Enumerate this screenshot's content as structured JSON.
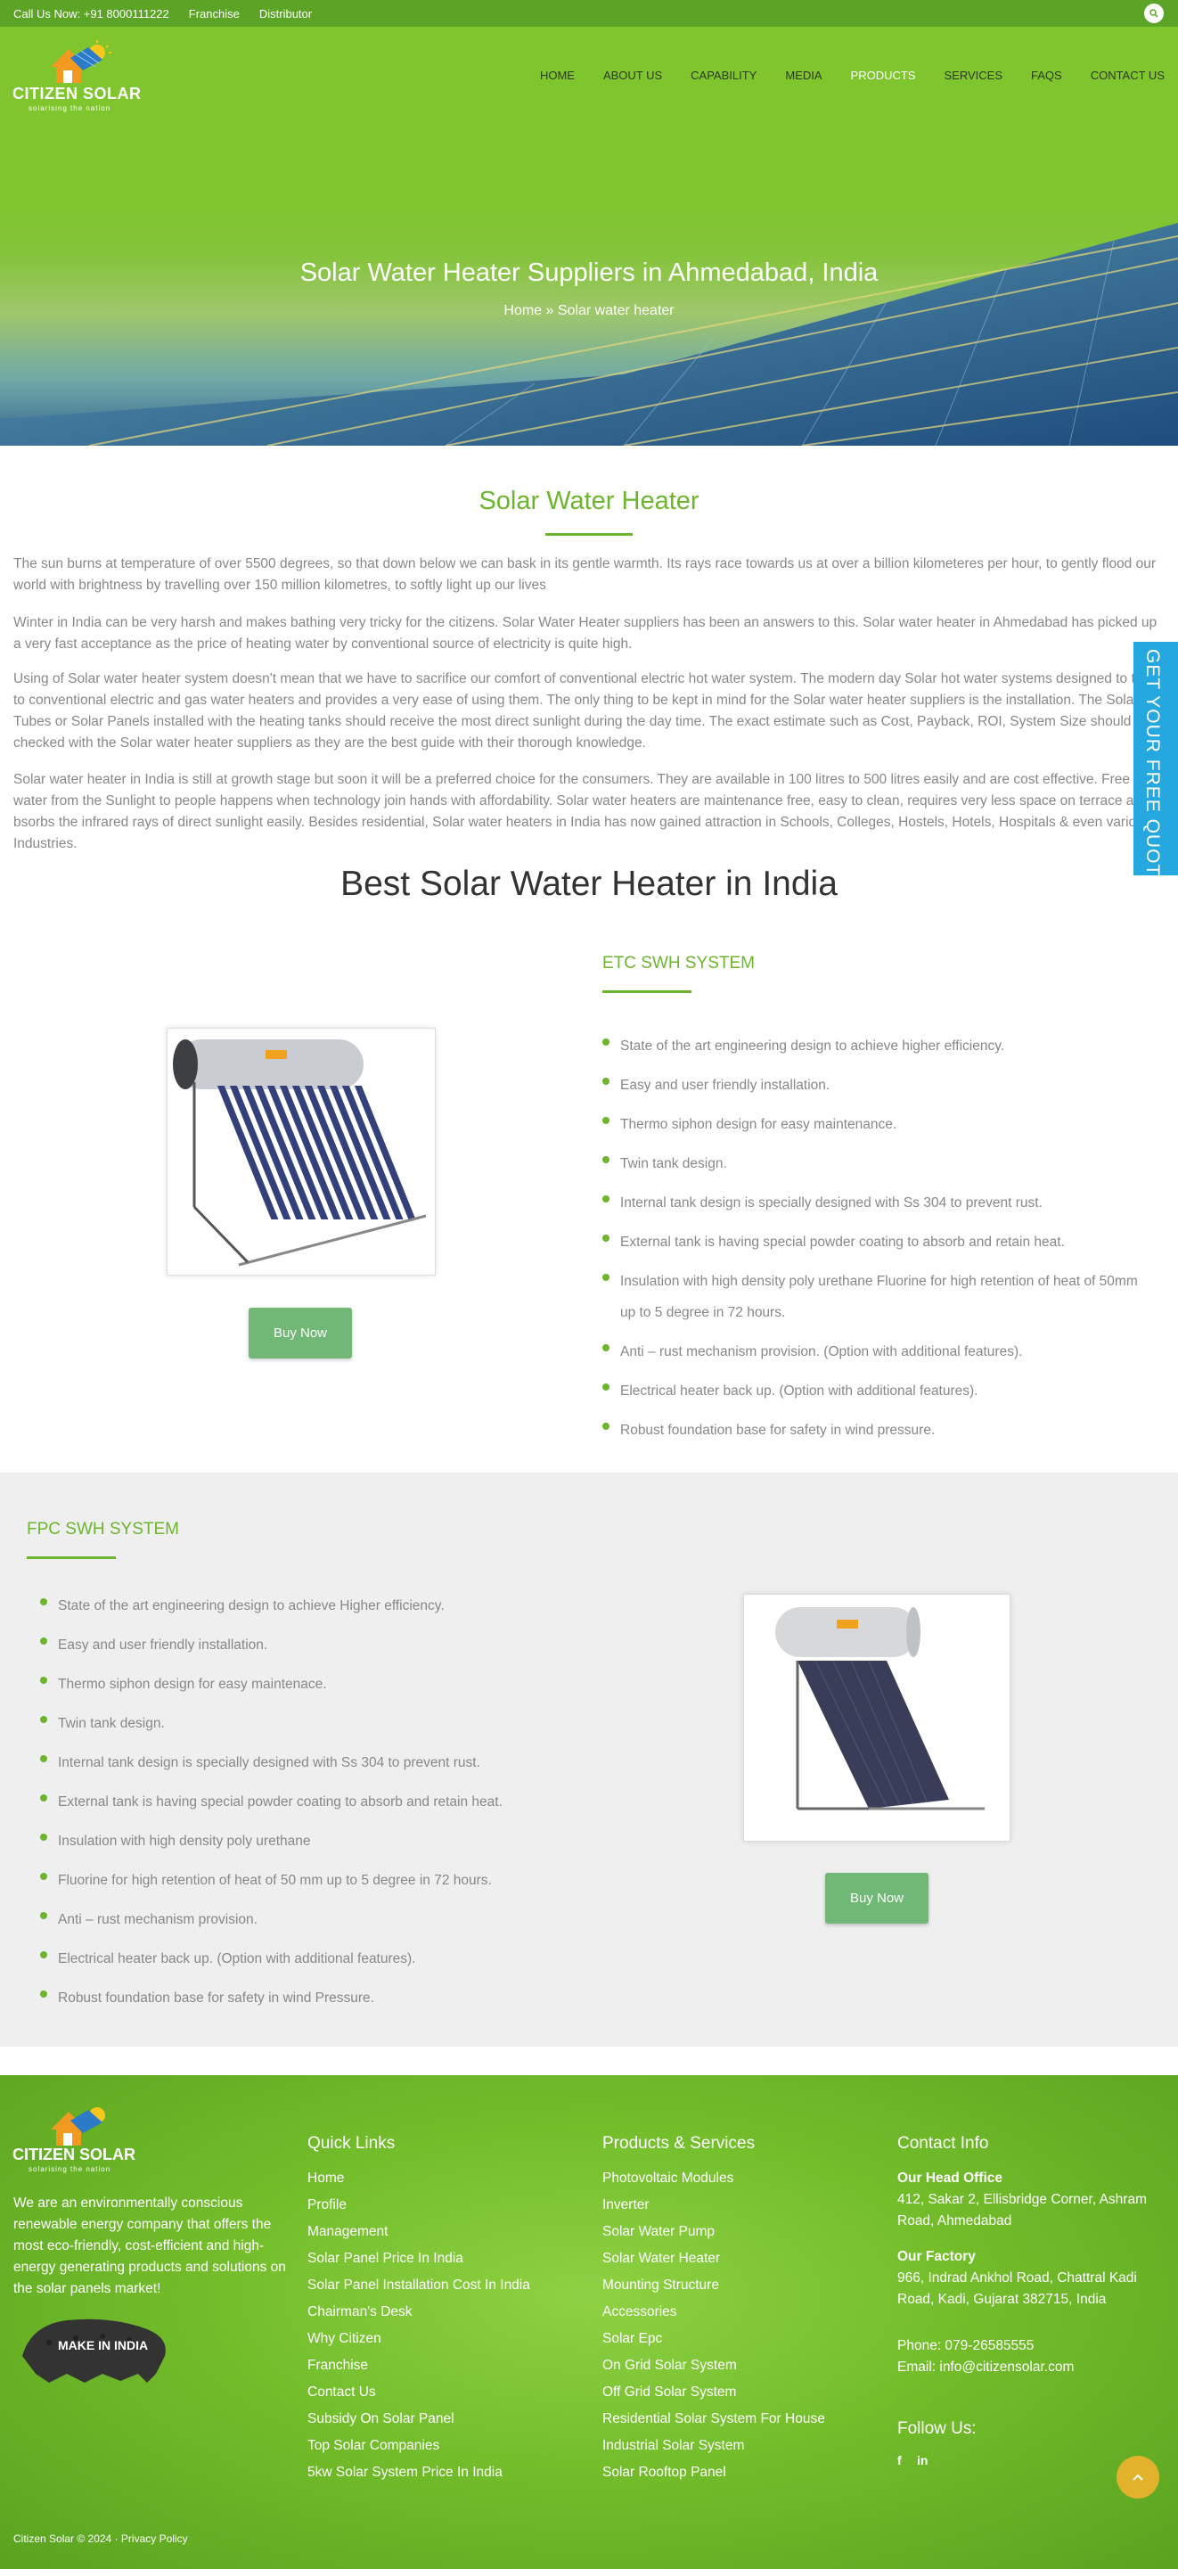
{
  "topbar": {
    "call": "Call Us Now: +91 8000111222",
    "franchise": "Franchise",
    "distributor": "Distributor"
  },
  "logo": {
    "name": "CITIZEN SOLAR",
    "tagline": "solarising the nation"
  },
  "nav": {
    "items": [
      {
        "label": "HOME"
      },
      {
        "label": "ABOUT US"
      },
      {
        "label": "CAPABILITY"
      },
      {
        "label": "MEDIA"
      },
      {
        "label": "PRODUCTS"
      },
      {
        "label": "SERVICES"
      },
      {
        "label": "FAQS"
      },
      {
        "label": "CONTACT US"
      }
    ],
    "active_index": 4
  },
  "hero": {
    "title": "Solar Water Heater Suppliers in Ahmedabad, India",
    "breadcrumb_home": "Home",
    "breadcrumb_sep": " » ",
    "breadcrumb_current": "Solar water heater"
  },
  "intro": {
    "title": "Solar Water Heater",
    "paragraphs": [
      "The sun burns at temperature of over 5500 degrees, so that down below we can bask in its gentle warmth. Its rays race towards us at over a billion kilometeres per hour, to gently flood our world with brightness by travelling over 150 million kilometres, to softly light up our lives",
      "Winter in India can be very harsh and makes bathing very tricky for the citizens. Solar Water Heater suppliers has been an answers to this. Solar water heater in Ahmedabad has picked up a very fast acceptance as the price of heating water by conventional source of electricity is quite high.",
      "Using of Solar water heater system doesn't mean that we have to sacrifice our comfort of conventional electric hot water system. The modern day Solar hot water systems designed to tie in to conventional electric and gas water heaters and provides a very ease of using them. The only thing to be kept in mind for the Solar water heater suppliers is the installation. The Solar Tubes or Solar Panels installed with the heating tanks should receive the most direct sunlight during the day time. The exact estimate such as Cost, Payback, ROI, System Size should be checked with the Solar water heater suppliers as they are the best guide with their thorough knowledge.",
      "Solar water heater in India is still at growth stage but soon it will be a preferred choice for the consumers. They are available in 100 litres to 500 litres easily and are cost effective. Free hot water from the Sunlight to people happens when technology join hands with affordability. Solar water heaters are maintenance free, easy to clean, requires very less space on terrace and bsorbs the infrared rays of direct sunlight easily. Besides residential, Solar water heaters in India has now gained attraction in Schools, Colleges, Hostels, Hotels, Hospitals & even various Industries."
    ]
  },
  "best_title": "Best Solar Water Heater in India",
  "etc": {
    "title": "ETC SWH SYSTEM",
    "buy_label": "Buy Now",
    "features": [
      "State of the art engineering design to achieve higher efficiency.",
      "Easy and user friendly installation.",
      "Thermo siphon design for easy maintenance.",
      "Twin tank design.",
      "Internal tank design is specially designed with Ss 304 to prevent rust.",
      "External tank is having special powder coating to absorb and retain heat.",
      "Insulation with high density poly urethane Fluorine for high retention of heat of 50mm up to 5 degree in 72 hours.",
      "Anti – rust mechanism provision. (Option with additional features).",
      "Electrical heater back up. (Option with additional features).",
      "Robust foundation base for safety in wind pressure."
    ]
  },
  "fpc": {
    "title": "FPC SWH SYSTEM",
    "buy_label": "Buy Now",
    "features": [
      "State of the art engineering design to achieve Higher efficiency.",
      "Easy and user friendly installation.",
      "Thermo siphon design for easy maintenace.",
      "Twin tank design.",
      "Internal tank design is specially designed with Ss 304 to prevent rust.",
      "External tank is having special powder coating to absorb and retain heat.",
      "Insulation with high density poly urethane",
      "Fluorine for high retention of heat of 50 mm up to 5 degree in 72 hours.",
      "Anti – rust mechanism provision.",
      "Electrical heater back up. (Option with additional features).",
      "Robust foundation base for safety in wind Pressure."
    ]
  },
  "quote_tab": "GET YOUR FREE QUOTE",
  "footer": {
    "about": "We are an environmentally conscious renewable energy company that offers the most eco-friendly, cost-efficient and high-energy generating products and solutions on the solar panels market!",
    "make_in_india": "MAKE IN INDIA",
    "quick_links_title": "Quick Links",
    "quick_links": [
      "Home",
      "Profile",
      "Management",
      "Solar Panel Price In India",
      "Solar Panel Installation Cost In India",
      "Chairman's Desk",
      "Why Citizen",
      "Franchise",
      "Contact Us",
      "Subsidy On Solar Panel",
      "Top Solar Companies",
      "5kw Solar System Price In India"
    ],
    "products_title": "Products & Services",
    "products": [
      "Photovoltaic Modules",
      "Inverter",
      "Solar Water Pump",
      "Solar Water Heater",
      "Mounting Structure",
      "Accessories",
      "Solar Epc",
      "On Grid Solar System",
      "Off Grid Solar System",
      "Residential Solar System For House",
      "Industrial Solar System",
      "Solar Rooftop Panel"
    ],
    "contact_title": "Contact Info",
    "head_office_label": "Our Head Office",
    "head_office_line1": "412, Sakar 2, Ellisbridge Corner, Ashram",
    "head_office_line2": "Road, Ahmedabad",
    "factory_label": "Our Factory",
    "factory_line1": "966, Indrad Ankhol Road, Chattral Kadi",
    "factory_line2": "Road, Kadi, Gujarat 382715, India",
    "phone": "Phone: 079-26585555",
    "email": "Email: info@citizensolar.com",
    "follow_title": "Follow Us:",
    "copyright": "Citizen Solar © 2024 · Privacy Policy"
  },
  "colors": {
    "brand_green": "#6cb52d",
    "topbar": "#5ba426",
    "quote_blue": "#25a8e0",
    "button_green": "#71b776",
    "scroll_top": "#e2b22c"
  }
}
